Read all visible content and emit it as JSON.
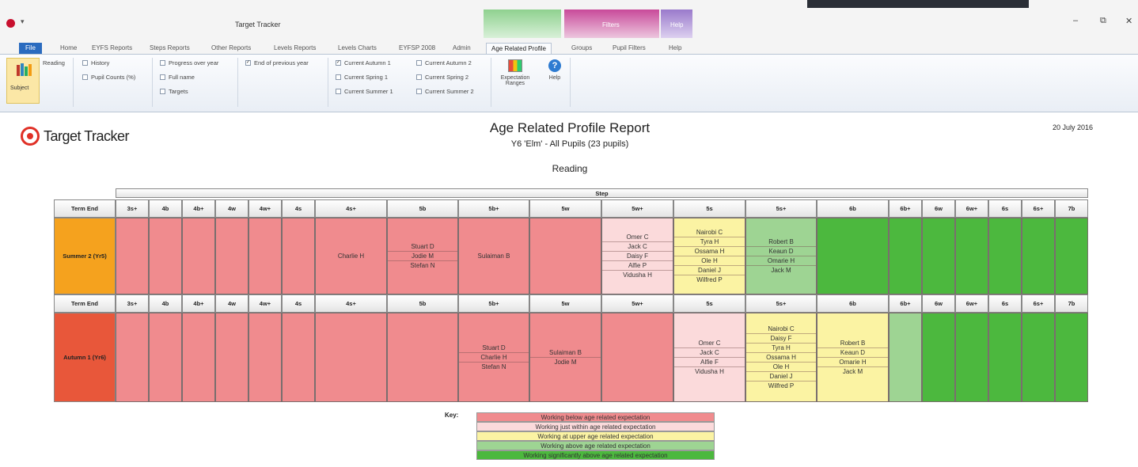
{
  "app": {
    "title": "Target Tracker",
    "quick_access": "▾",
    "context_groups": [
      "Filters",
      "Help"
    ],
    "window_controls": {
      "minimize": "–",
      "restore": "⧉",
      "close": "✕"
    }
  },
  "tabs": [
    "File",
    "Home",
    "EYFS Reports",
    "Steps Reports",
    "Other Reports",
    "Levels Reports",
    "Levels Charts",
    "EYFSP 2008",
    "Admin",
    "Age Related Profile",
    "Groups",
    "Pupil Filters",
    "Help"
  ],
  "ribbon": {
    "subject_label": "Subject",
    "subject_value": "Reading",
    "options_col1": [
      {
        "label": "History",
        "checked": false
      },
      {
        "label": "Pupil Counts (%)",
        "checked": false
      }
    ],
    "options_col2": [
      {
        "label": "Progress over year",
        "checked": false
      },
      {
        "label": "Full name",
        "checked": false
      },
      {
        "label": "Targets",
        "checked": false
      }
    ],
    "options_col3": [
      {
        "label": "End of previous year",
        "checked": true
      }
    ],
    "terms": [
      {
        "label": "Current Autumn 1",
        "checked": true
      },
      {
        "label": "Current Autumn 2",
        "checked": false
      },
      {
        "label": "Current Spring 1",
        "checked": false
      },
      {
        "label": "Current Spring 2",
        "checked": false
      },
      {
        "label": "Current Summer 1",
        "checked": false
      },
      {
        "label": "Current Summer 2",
        "checked": false
      }
    ],
    "expectation_label": "Expectation Ranges",
    "help_label": "Help"
  },
  "report": {
    "logo_text": "Target Tracker",
    "title": "Age Related Profile Report",
    "subtitle": "Y6 'Elm' - All Pupils (23 pupils)",
    "subject": "Reading",
    "date": "20 July 2016",
    "step_header": "Step",
    "term_end_header": "Term End",
    "steps": [
      "3s+",
      "4b",
      "4b+",
      "4w",
      "4w+",
      "4s",
      "4s+",
      "5b",
      "5b+",
      "5w",
      "5w+",
      "5s",
      "5s+",
      "6b",
      "6b+",
      "6w",
      "6w+",
      "6s",
      "6s+",
      "7b"
    ],
    "rows": [
      {
        "term": "Summer 2 (Yr5)",
        "term_color": "#f5a21e",
        "cells": [
          {
            "status": "red",
            "names": []
          },
          {
            "status": "red",
            "names": []
          },
          {
            "status": "red",
            "names": []
          },
          {
            "status": "red",
            "names": []
          },
          {
            "status": "red",
            "names": []
          },
          {
            "status": "red",
            "names": []
          },
          {
            "status": "red",
            "names": [
              "Charlie H"
            ]
          },
          {
            "status": "red",
            "names": [
              "Stuart D",
              "Jodie M",
              "Stefan N"
            ]
          },
          {
            "status": "red",
            "names": [
              "Sulaiman B"
            ]
          },
          {
            "status": "red",
            "names": []
          },
          {
            "status": "pink",
            "names": [
              "Omer C",
              "Jack C",
              "Daisy F",
              "Alfie P",
              "Vidusha H"
            ]
          },
          {
            "status": "yellow",
            "names": [
              "Nairobi C",
              "Tyra H",
              "Ossama H",
              "Ole H",
              "Daniel J",
              "Wilfred P"
            ]
          },
          {
            "status": "lgreen",
            "names": [
              "Robert B",
              "Keaun D",
              "Omarie H",
              "Jack M"
            ]
          },
          {
            "status": "green",
            "names": []
          },
          {
            "status": "green",
            "names": []
          },
          {
            "status": "green",
            "names": []
          },
          {
            "status": "green",
            "names": []
          },
          {
            "status": "green",
            "names": []
          },
          {
            "status": "green",
            "names": []
          },
          {
            "status": "green",
            "names": []
          }
        ]
      },
      {
        "term": "Autumn 1 (Yr6)",
        "term_color": "#e8573a",
        "cells": [
          {
            "status": "red",
            "names": []
          },
          {
            "status": "red",
            "names": []
          },
          {
            "status": "red",
            "names": []
          },
          {
            "status": "red",
            "names": []
          },
          {
            "status": "red",
            "names": []
          },
          {
            "status": "red",
            "names": []
          },
          {
            "status": "red",
            "names": []
          },
          {
            "status": "red",
            "names": []
          },
          {
            "status": "red",
            "names": [
              "Stuart D",
              "Charlie H",
              "Stefan N"
            ]
          },
          {
            "status": "red",
            "names": [
              "Sulaiman B",
              "Jodie M"
            ]
          },
          {
            "status": "red",
            "names": []
          },
          {
            "status": "pink",
            "names": [
              "Omer C",
              "Jack C",
              "Alfie F",
              "Vidusha H"
            ]
          },
          {
            "status": "yellow",
            "names": [
              "Nairobi C",
              "Daisy F",
              "Tyra H",
              "Ossama H",
              "Ole H",
              "Daniel J",
              "Wilfred P"
            ]
          },
          {
            "status": "yellow",
            "names": [
              "Robert B",
              "Keaun D",
              "Omarie H",
              "Jack M"
            ]
          },
          {
            "status": "lgreen",
            "names": []
          },
          {
            "status": "green",
            "names": []
          },
          {
            "status": "green",
            "names": []
          },
          {
            "status": "green",
            "names": []
          },
          {
            "status": "green",
            "names": []
          },
          {
            "status": "green",
            "names": []
          }
        ]
      }
    ]
  },
  "key": {
    "label": "Key:",
    "items": [
      {
        "text": "Working below age related expectation",
        "color": "#f08b8e"
      },
      {
        "text": "Working just within age related expectation",
        "color": "#fbdadb"
      },
      {
        "text": "Working at upper age related expectation",
        "color": "#fbf3a3"
      },
      {
        "text": "Working above age related expectation",
        "color": "#9ed493"
      },
      {
        "text": "Working significantly above age related expectation",
        "color": "#4cb83e"
      }
    ]
  }
}
